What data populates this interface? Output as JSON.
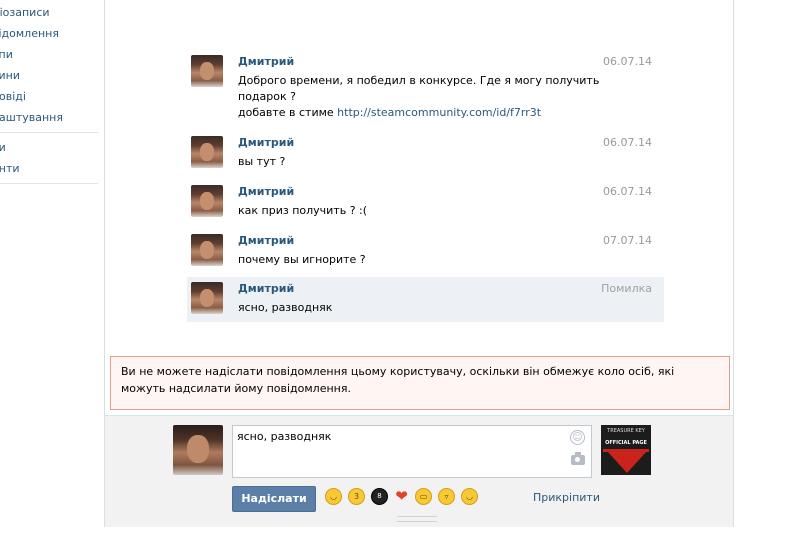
{
  "sidebar": {
    "items": [
      {
        "label": "Аудіозаписи",
        "visible": "діозаписи"
      },
      {
        "label": "Повідомлення",
        "visible": "відомлення"
      },
      {
        "label": "Групи",
        "visible": "упи"
      },
      {
        "label": "Новини",
        "visible": "вини"
      },
      {
        "label": "Відповіді",
        "visible": "ловіді"
      },
      {
        "label": "Налаштування",
        "visible": "лаштування"
      }
    ],
    "items2": [
      {
        "label": "Документи",
        "visible": "ки"
      },
      {
        "label": "Коментарі",
        "visible": "енти"
      }
    ]
  },
  "messages": [
    {
      "author": "Дмитрий",
      "date": "06.07.14",
      "lines": [
        "Доброго времени, я победил в конкурсе. Где я могу получить",
        "подарок ?",
        "добавте в стиме "
      ],
      "link": "http://steamcommunity.com/id/f7rr3t"
    },
    {
      "author": "Дмитрий",
      "date": "06.07.14",
      "text": "вы тут ?"
    },
    {
      "author": "Дмитрий",
      "date": "06.07.14",
      "text": "как приз получить ? :("
    },
    {
      "author": "Дмитрий",
      "date": "07.07.14",
      "text": "почему вы игнорите ?"
    },
    {
      "author": "Дмитрий",
      "date": "Помилка",
      "text": "ясно, разводняк"
    }
  ],
  "warning": "Ви не можете надіслати повідомлення цьому користувачу, оскільки він обмежує коло осіб, які можуть надсилати йому повідомлення.",
  "composer": {
    "draft": "ясно, разводняк",
    "send_label": "Надіслати",
    "attach_label": "Прикріпити",
    "game_thumb_line1": "TREASURE KEY",
    "game_thumb_line2": "OFFICIAL PAGE",
    "emojis": [
      "smile-emoji",
      "wink-kiss-emoji",
      "eight-ball-emoji",
      "heart-emoji",
      "grin-emoji",
      "laugh-emoji",
      "blush-emoji"
    ]
  },
  "colors": {
    "link": "#2b587a",
    "send_button": "#5b7fa6",
    "warning_bg": "#fff5f3",
    "warning_border": "#e89c8d",
    "error_row_bg": "#edf1f5"
  }
}
